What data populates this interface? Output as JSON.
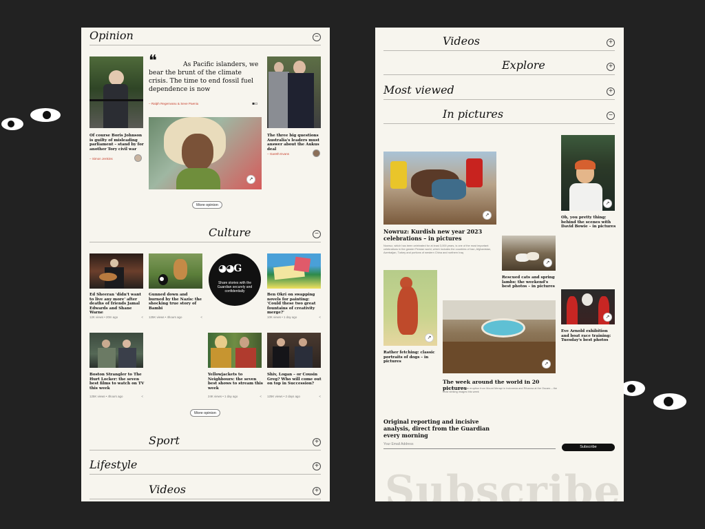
{
  "colors": {
    "background": "#222222",
    "panel": "#f7f5ee",
    "accent": "#c7402d",
    "dark": "#111111"
  },
  "left": {
    "opinion": {
      "title": "Opinion",
      "toggle": "−",
      "quote_mark": "❝",
      "quote": "As Pacific islanders, we bear the brunt of the climate crisis. The time to end fossil fuel dependence is now",
      "quote_author": "– Ralph Regenvanu & Seve Paeniu",
      "left_caption": "Of course Boris Johnson is guilty of misleading parliament – stand by for another Tory civil war",
      "left_author": "– Simon Jenkins",
      "right_caption": "The three big questions Australia's leaders must answer about the Aukus deal",
      "right_author": "– Gareth Evans",
      "more": "More opinion"
    },
    "culture": {
      "title": "Culture",
      "toggle": "−",
      "cards": [
        {
          "caption": "Ed Sheeran 'didn't want to live any more' after deaths of friends Jamal Edwards and Shane Warne",
          "views": "12K views",
          "time": "20m ago"
        },
        {
          "caption": "Gunned down and burned by the Nazis: the shocking true story of Bambi",
          "views": "125K views",
          "time": "4hours ago"
        },
        {
          "caption": "Share stories with the Guardian securely and confidentially"
        },
        {
          "caption": "Ben Okri on swapping novels for painting: 'Could these two great fountains of creativity merge?'",
          "views": "10K views",
          "time": "1 day ago"
        },
        {
          "caption": "Boston Strangler to The Hurt Locker: the seven best films to watch on TV this week",
          "views": "125K views",
          "time": "4hours ago"
        },
        {
          "caption": "Yellowjackets to Neighbours: the seven best shows to stream this week",
          "views": "24K views",
          "time": "1 day ago"
        },
        {
          "caption": "Shiv, Logan – or Cousin Greg? Who will come out on top in Succession?",
          "views": "125K views",
          "time": "2 days ago"
        }
      ],
      "more": "More opinion"
    },
    "sections": [
      {
        "title": "Sport",
        "toggle": "+"
      },
      {
        "title": "Lifestyle",
        "toggle": "+"
      },
      {
        "title": "Videos",
        "toggle": "+"
      }
    ]
  },
  "right": {
    "sections": [
      {
        "title": "Videos",
        "toggle": "+"
      },
      {
        "title": "Explore",
        "toggle": "+"
      },
      {
        "title": "Most viewed",
        "toggle": "+"
      },
      {
        "title": "In pictures",
        "toggle": "−"
      }
    ],
    "pictures": {
      "main_title": "Nowruz: Kurdish new year 2023 celebrations – in pictures",
      "main_desc": "Nowruz, which has been celebrated for at least 3,000 years, is one of the most important celebrations in the greater Persian world, which includes the countries of Iran, Afghanistan, Azerbaijan, Turkey and portions of western China and northern Iraq",
      "bowie": "Oh, you pretty thing: behind the scenes with David Bowie – in pictures",
      "lambs": "Rescued cats and spring lambs: the weekend's best photos – in pictures",
      "dogs": "Rather fetching: classic portraits of dogs – in pictures",
      "eve": "Eve Arnold exhibition and boat race training: Tuesday's best photos",
      "world_title": "The week around the world in 20 pictures",
      "world_desc": "Protests in France, an eruption from Mount Merapi in Indonesia and Rihanna at the Oscars – the most striking images this week"
    },
    "subscribe": {
      "headline": "Original reporting and incisive analysis, direct from the Guardian every morning",
      "placeholder": "Your Email Address",
      "button": "Subscribe",
      "watermark": "Subscribe"
    }
  }
}
